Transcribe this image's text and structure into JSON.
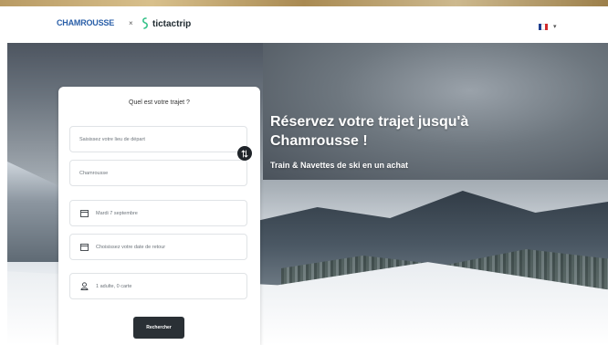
{
  "header": {
    "brand_primary": "CHAMROUSSE",
    "separator": "×",
    "brand_secondary": "tictactrip",
    "language": "FR",
    "flag_colors": [
      "#1f3f8f",
      "#ffffff",
      "#d22b2b"
    ]
  },
  "hero": {
    "title": "Réservez votre trajet jusqu'à Chamrousse !",
    "subtitle": "Train & Navettes de ski en un achat"
  },
  "form": {
    "title": "Quel est votre trajet ?",
    "origin_placeholder": "Saisissez votre lieu de départ",
    "destination_value": "Chamrousse",
    "departure_date": "Mardi 7 septembre",
    "return_date_placeholder": "Choisissez votre date de retour",
    "passengers": "1 adulte, 0 carte",
    "search_label": "Rechercher"
  },
  "icons": {
    "calendar": "calendar-icon",
    "user": "user-icon",
    "swap": "swap-icon"
  },
  "colors": {
    "primary_dark": "#2a3035",
    "brand_blue": "#2a5fa8",
    "tictactrip_green": "#37c28a"
  }
}
